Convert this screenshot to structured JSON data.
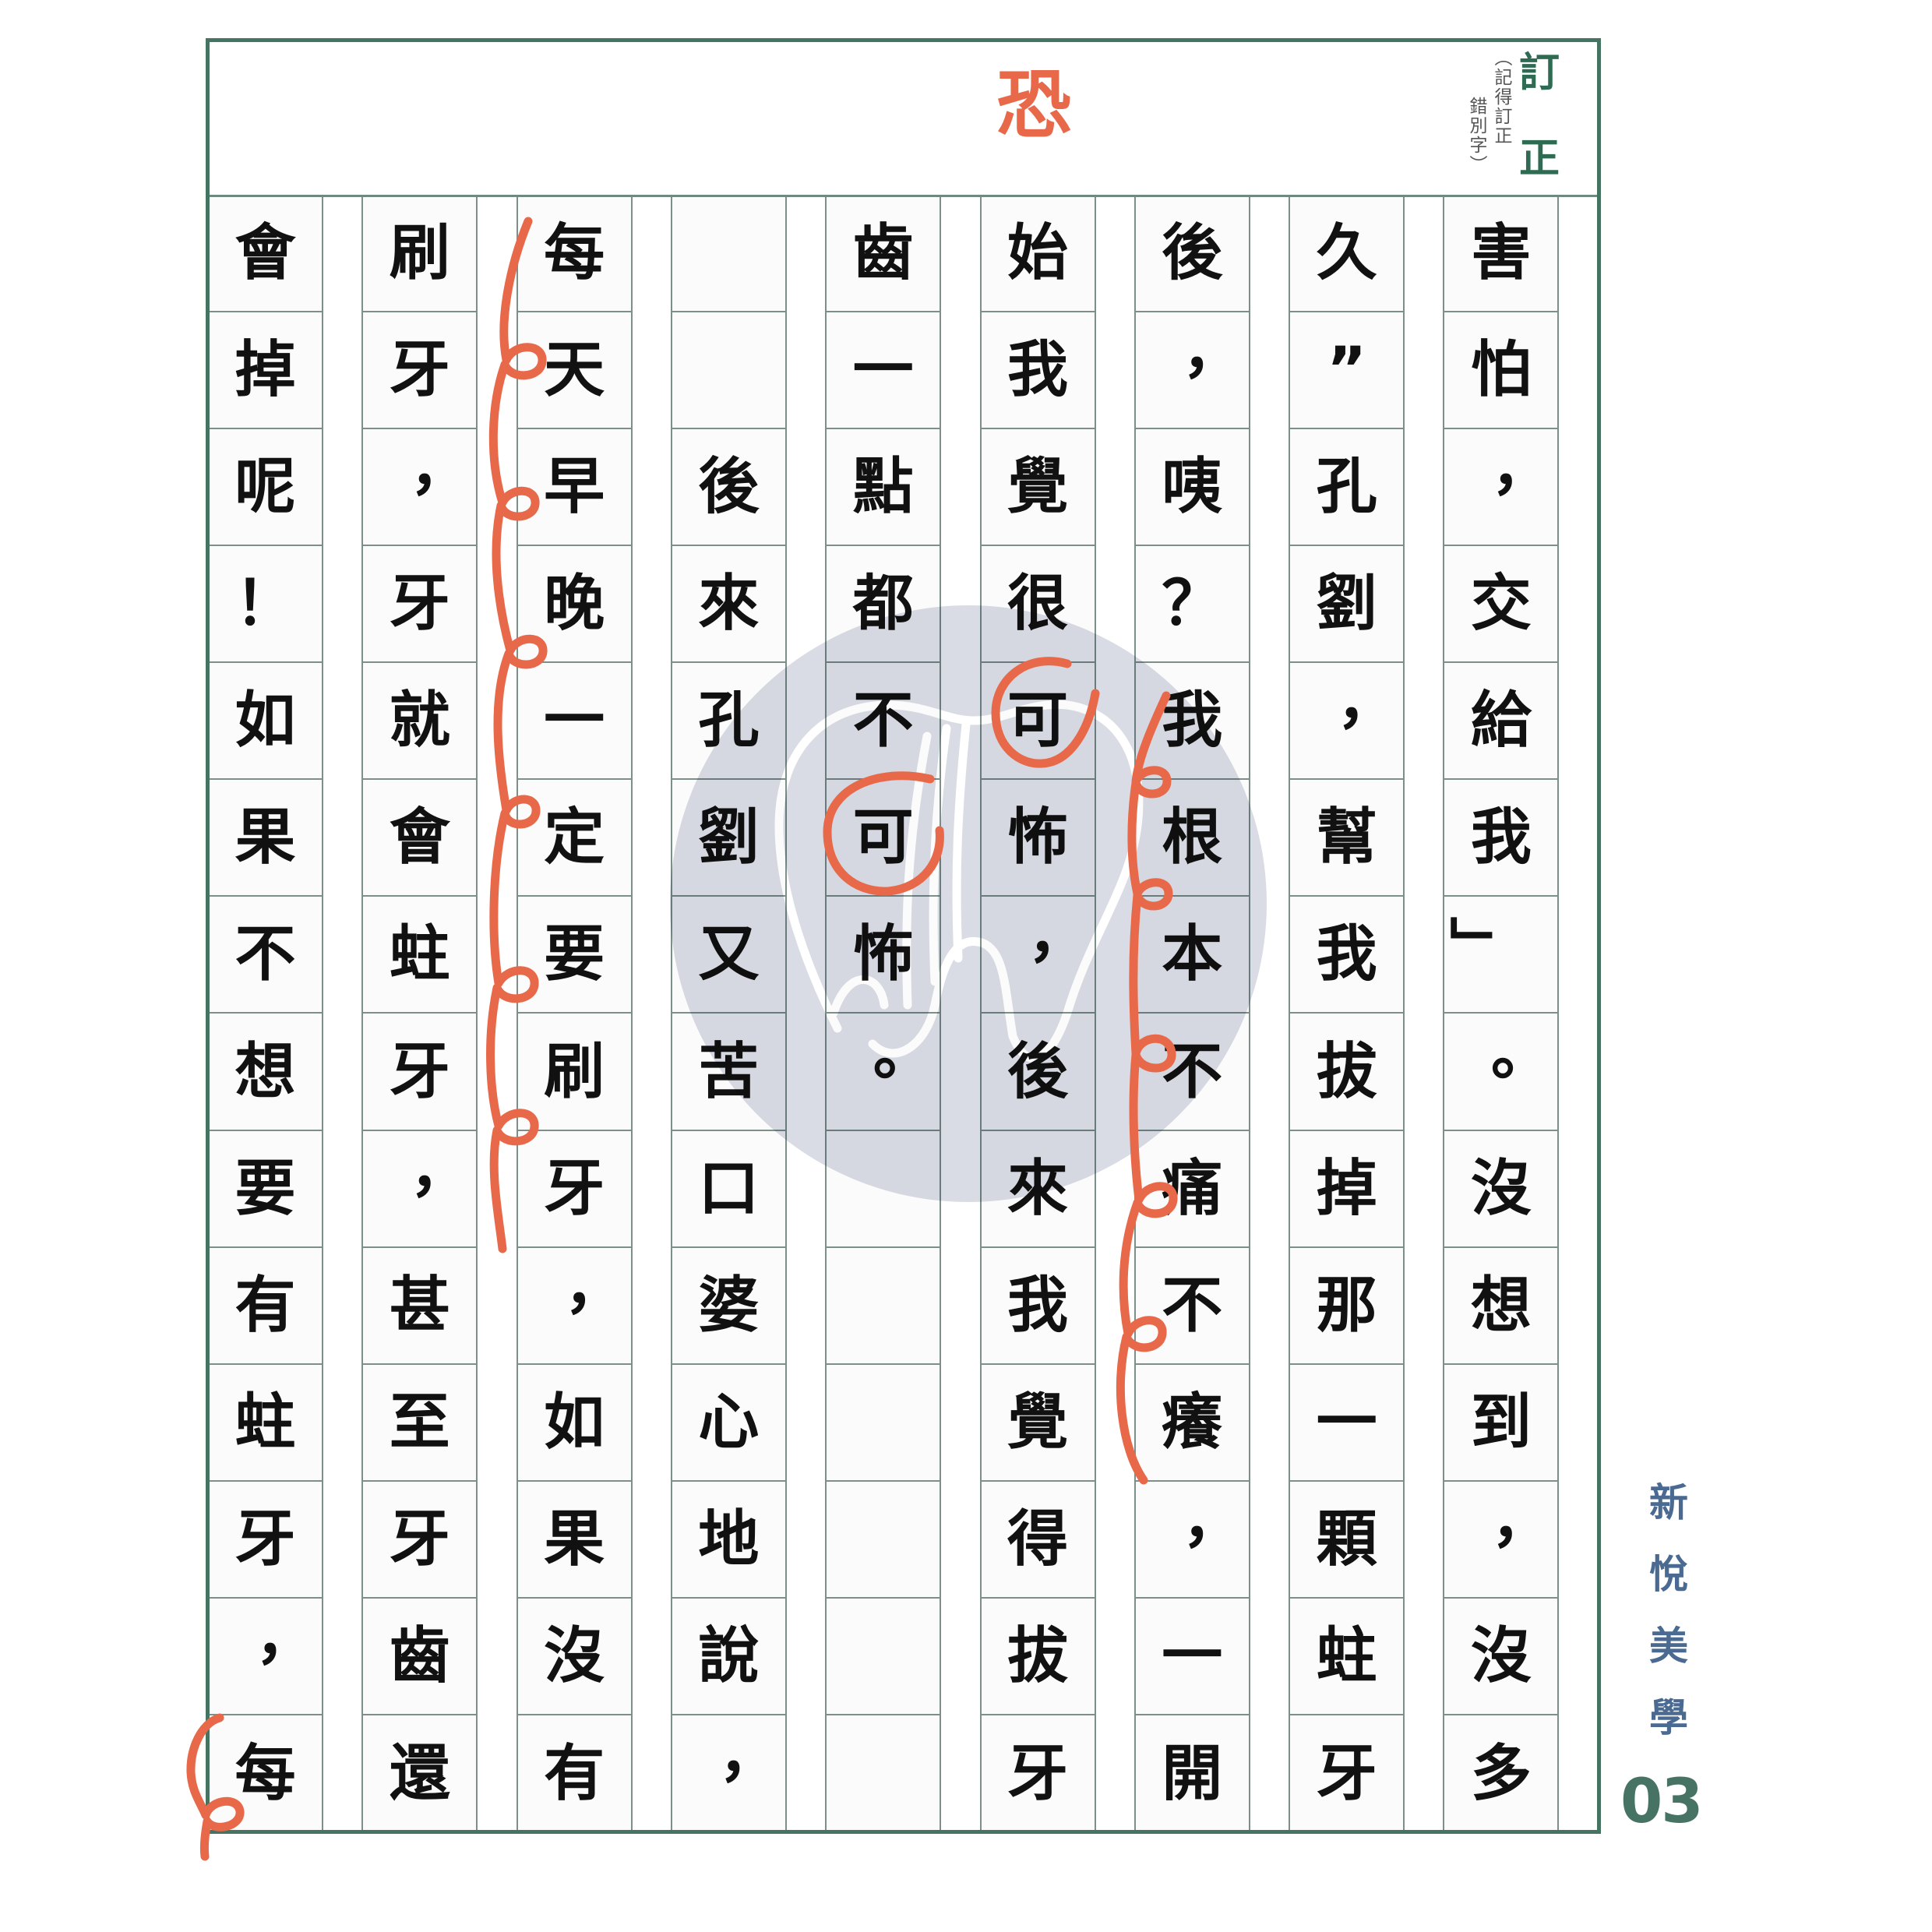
{
  "header": {
    "correction_character": "恐",
    "correction_label_top": "訂",
    "correction_label_bottom": "正",
    "correction_note_line1": "（記得訂正",
    "correction_note_line2": "錯別字）"
  },
  "manuscript": {
    "reading_direction": "vertical, right-to-left",
    "rows_per_column": 14,
    "columns": [
      [
        "害",
        "怕",
        "，",
        "交",
        "給",
        "我",
        "」",
        "。",
        "沒",
        "想",
        "到",
        "，",
        "沒",
        "多"
      ],
      [
        "久",
        "”",
        "孔",
        "劉",
        "，",
        "幫",
        "我",
        "拔",
        "掉",
        "那",
        "一",
        "顆",
        "蛀",
        "牙"
      ],
      [
        "後",
        "，",
        "咦",
        "？",
        "我",
        "根",
        "本",
        "不",
        "痛",
        "不",
        "癢",
        "，",
        "一",
        "開"
      ],
      [
        "始",
        "我",
        "覺",
        "很",
        "可",
        "怖",
        "，",
        "後",
        "來",
        "我",
        "覺",
        "得",
        "拔",
        "牙"
      ],
      [
        "齒",
        "一",
        "點",
        "都",
        "不",
        "可",
        "怖",
        "。",
        "",
        "",
        "",
        "",
        "",
        ""
      ],
      [
        "",
        "",
        "後",
        "來",
        "孔",
        "劉",
        "又",
        "苦",
        "口",
        "婆",
        "心",
        "地",
        "說",
        "，"
      ],
      [
        "每",
        "天",
        "早",
        "晚",
        "一",
        "定",
        "要",
        "刷",
        "牙",
        "，",
        "如",
        "果",
        "沒",
        "有"
      ],
      [
        "刷",
        "牙",
        "，",
        "牙",
        "就",
        "會",
        "蛀",
        "牙",
        "，",
        "甚",
        "至",
        "牙",
        "齒",
        "還"
      ],
      [
        "會",
        "掉",
        "呢",
        "！",
        "如",
        "果",
        "不",
        "想",
        "要",
        "有",
        "蛀",
        "牙",
        "，",
        "每"
      ]
    ]
  },
  "annotations": {
    "circled_characters": [
      "可",
      "可"
    ],
    "squiggle_marks": 3
  },
  "brand": {
    "name": "新悅美學",
    "page_number": "03"
  },
  "colors": {
    "frame": "#457462",
    "grid": "#7c8f89",
    "annotation": "#e8694a",
    "brand_text": "#4b6a92",
    "page_number": "#467363",
    "watermark": "#d9dce4",
    "correction_label": "#2f6b52"
  }
}
